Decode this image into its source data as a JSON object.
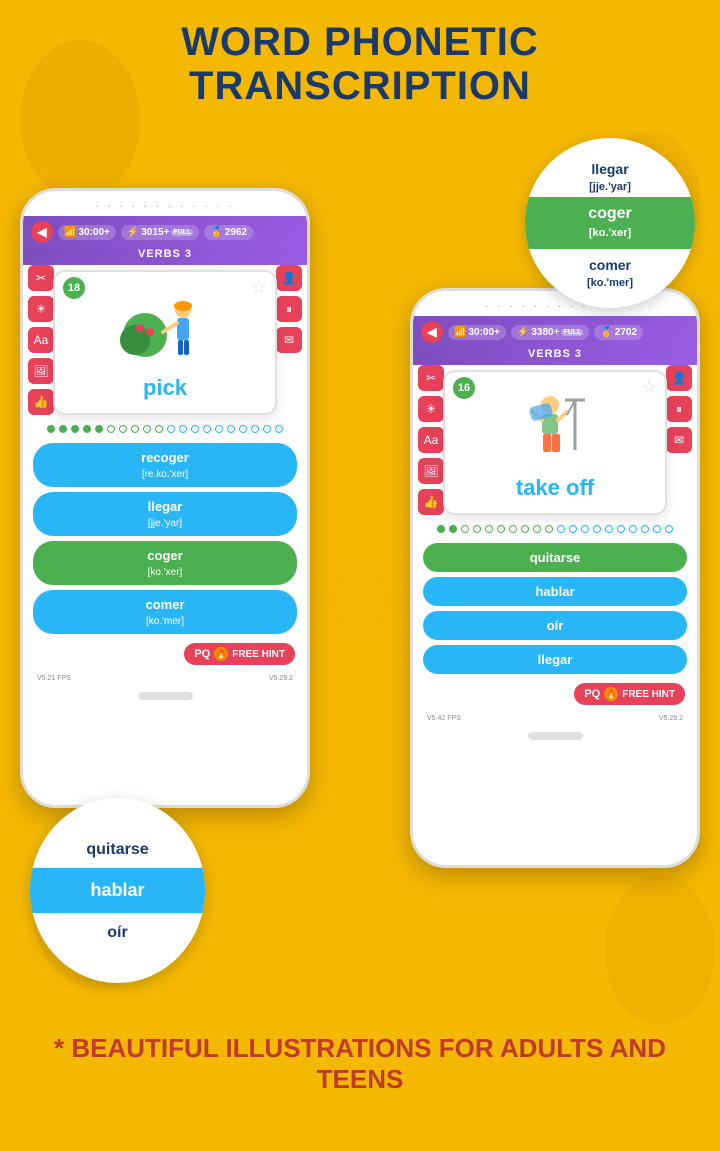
{
  "title": {
    "line1": "WORD PHONETIC",
    "line2": "TRANSCRIPTION"
  },
  "bottom_text": "* BEAUTIFUL ILLUSTRATIONS FOR ADULTS AND TEENS",
  "phone_left": {
    "speaker": "· · · · · · · · · · · ·",
    "stats": {
      "time": "30:00+",
      "points": "3015+",
      "full_label": "FULL",
      "coins": "2962"
    },
    "section": "VERBS 3",
    "card_number": "18",
    "word": "pick",
    "answers": [
      {
        "text": "recoger",
        "phonetic": "[re.ko.'xer]",
        "type": "blue"
      },
      {
        "text": "llegar",
        "phonetic": "[jje.'yar]",
        "type": "blue"
      },
      {
        "text": "coger",
        "phonetic": "[ko.'xer]",
        "type": "green"
      },
      {
        "text": "comer",
        "phonetic": "[ko.'mer]",
        "type": "blue"
      }
    ],
    "hint_label": "FREE HINT",
    "fps": "V5.21 FPS",
    "version": "V5.29.2",
    "dots_filled": 5,
    "dots_total": 20
  },
  "phone_right": {
    "speaker": "· · · · · · · · · · · ·",
    "stats": {
      "time": "30:00+",
      "points": "3380+",
      "full_label": "FULL",
      "coins": "2702"
    },
    "section": "VERBS 3",
    "card_number": "16",
    "word": "take off",
    "answers": [
      {
        "text": "quitarse",
        "type": "green"
      },
      {
        "text": "hablar",
        "type": "blue"
      },
      {
        "text": "oír",
        "type": "blue"
      },
      {
        "text": "llegar",
        "type": "blue"
      }
    ],
    "hint_label": "FREE HINT",
    "fps": "V5.42 FPS",
    "version": "V5.29.2",
    "dots_filled": 2,
    "dots_total": 20
  },
  "circle_right": {
    "items": [
      {
        "text": "llegar",
        "phonetic": "[jje.'yar]",
        "type": "normal"
      },
      {
        "text": "coger",
        "phonetic": "[ko.'xer]",
        "type": "green"
      },
      {
        "text": "comer",
        "phonetic": "[ko.'mer]",
        "type": "normal"
      }
    ]
  },
  "circle_left": {
    "items": [
      {
        "text": "quitarse",
        "type": "normal"
      },
      {
        "text": "hablar",
        "type": "green"
      },
      {
        "text": "oír",
        "type": "normal"
      }
    ]
  }
}
